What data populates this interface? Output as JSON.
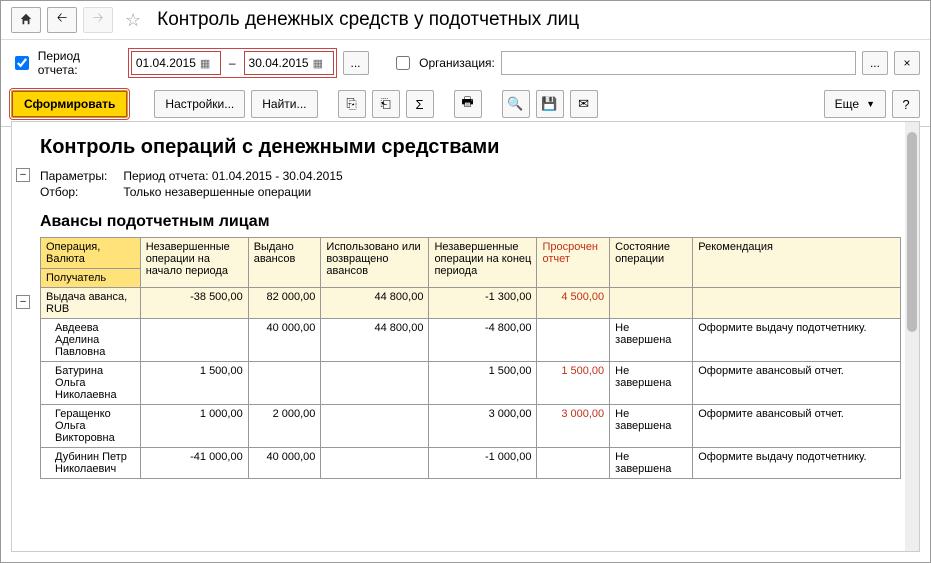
{
  "header": {
    "title": "Контроль денежных средств у подотчетных лиц"
  },
  "params": {
    "period_label": "Период отчета:",
    "date_from": "01.04.2015",
    "date_to": "30.04.2015",
    "dots": "...",
    "org_label": "Организация:",
    "org_value": "",
    "clear_x": "×"
  },
  "toolbar": {
    "generate": "Сформировать",
    "settings": "Настройки...",
    "find": "Найти...",
    "more": "Еще",
    "help": "?"
  },
  "report": {
    "title": "Контроль операций с денежными средствами",
    "param_label": "Параметры:",
    "param_value": "Период отчета: 01.04.2015 - 30.04.2015",
    "filter_label": "Отбор:",
    "filter_value": "Только незавершенные операции",
    "subtitle": "Авансы подотчетным лицам"
  },
  "table": {
    "headers": {
      "op": "Операция, Валюта",
      "recipient": "Получатель",
      "open_start": "Незавершенные операции на начало периода",
      "issued": "Выдано авансов",
      "used": "Использовано или возвращено авансов",
      "open_end": "Незавершенные операции на конец периода",
      "overdue": "Просрочен отчет",
      "state": "Состояние операции",
      "reco": "Рекомендация"
    },
    "total": {
      "name": "Выдача аванса, RUB",
      "open_start": "-38 500,00",
      "issued": "82 000,00",
      "used": "44 800,00",
      "open_end": "-1 300,00",
      "overdue": "4 500,00"
    },
    "rows": [
      {
        "name": "Авдеева Аделина Павловна",
        "open_start": "",
        "issued": "40 000,00",
        "used": "44 800,00",
        "open_end": "-4 800,00",
        "overdue": "",
        "state": "Не завершена",
        "reco": "Оформите выдачу подотчетнику."
      },
      {
        "name": "Батурина Ольга Николаевна",
        "open_start": "1 500,00",
        "issued": "",
        "used": "",
        "open_end": "1 500,00",
        "overdue": "1 500,00",
        "state": "Не завершена",
        "reco": "Оформите авансовый отчет."
      },
      {
        "name": "Геращенко Ольга Викторовна",
        "open_start": "1 000,00",
        "issued": "2 000,00",
        "used": "",
        "open_end": "3 000,00",
        "overdue": "3 000,00",
        "state": "Не завершена",
        "reco": "Оформите авансовый отчет."
      },
      {
        "name": "Дубинин Петр Николаевич",
        "open_start": "-41 000,00",
        "issued": "40 000,00",
        "used": "",
        "open_end": "-1 000,00",
        "overdue": "",
        "state": "Не завершена",
        "reco": "Оформите выдачу подотчетнику."
      }
    ]
  }
}
